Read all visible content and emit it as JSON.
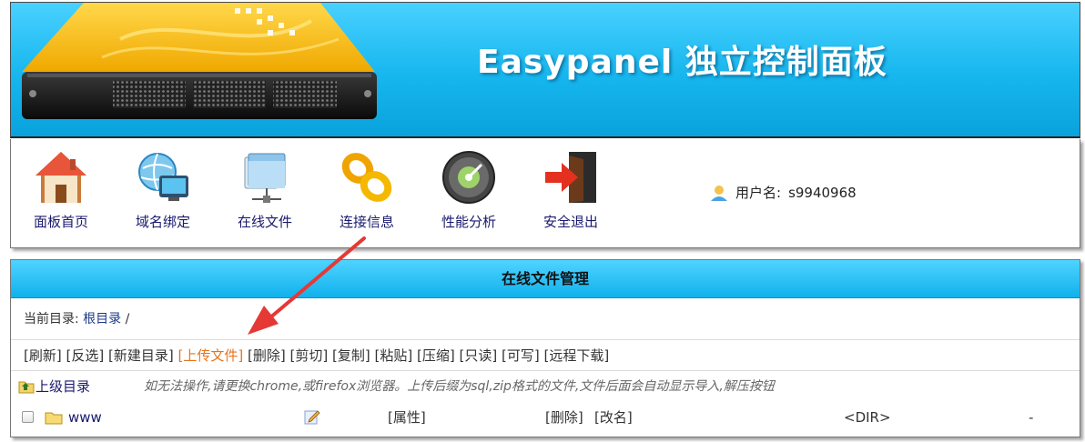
{
  "banner": {
    "brand": "Easypanel 独立控制面板"
  },
  "nav": {
    "items": [
      {
        "label": "面板首页",
        "icon": "home-icon"
      },
      {
        "label": "域名绑定",
        "icon": "globe-monitor-icon"
      },
      {
        "label": "在线文件",
        "icon": "folder-network-icon"
      },
      {
        "label": "连接信息",
        "icon": "chain-link-icon"
      },
      {
        "label": "性能分析",
        "icon": "gauge-icon"
      },
      {
        "label": "安全退出",
        "icon": "exit-door-icon"
      }
    ],
    "user_label": "用户名:",
    "username": "s9940968"
  },
  "file_manager": {
    "title": "在线文件管理",
    "current_dir_label": "当前目录:",
    "current_dir_link": "根目录",
    "current_dir_sep": "/",
    "toolbar": [
      {
        "label": "[刷新]"
      },
      {
        "label": "[反选]"
      },
      {
        "label": "[新建目录]"
      },
      {
        "label": "[上传文件]",
        "active": true
      },
      {
        "label": "[删除]"
      },
      {
        "label": "[剪切]"
      },
      {
        "label": "[复制]"
      },
      {
        "label": "[粘贴]"
      },
      {
        "label": "[压缩]"
      },
      {
        "label": "[只读]"
      },
      {
        "label": "[可写]"
      },
      {
        "label": "[远程下载]"
      }
    ],
    "parent_dir": "上级目录",
    "hint": "如无法操作,请更换chrome,或firefox浏览器。上传后缀为sql,zip格式的文件,文件后面会自动显示导入,解压按钮",
    "files": [
      {
        "name": "www",
        "props": "[属性]",
        "delete": "[删除]",
        "rename": "[改名]",
        "size": "<DIR>",
        "extra": "-"
      }
    ]
  },
  "colors": {
    "banner_blue": "#16b6ee",
    "active_orange": "#e8731a",
    "arrow_red": "#e53935"
  }
}
